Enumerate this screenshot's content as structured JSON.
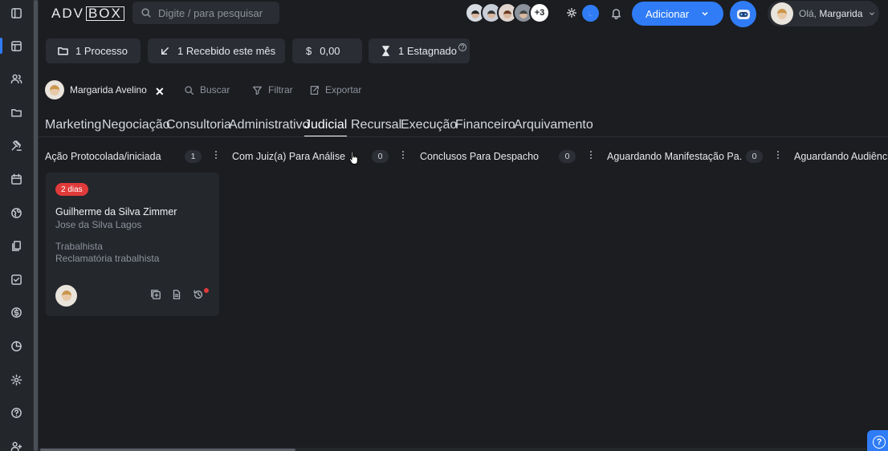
{
  "app": {
    "logo_left": "ADV",
    "logo_right": "BOX"
  },
  "search": {
    "placeholder": "Digite / para pesquisar"
  },
  "team": {
    "more_label": "+3"
  },
  "header": {
    "add_label": "Adicionar",
    "greeting": "Olá,",
    "user_name": "Margarida"
  },
  "stats": {
    "processes": "1 Processo",
    "received": "1 Recebido este mês",
    "amount_symbol": "$",
    "amount": "0,00",
    "stagnant": "1 Estagnado",
    "stagnant_help": "?"
  },
  "filters": {
    "user": "Margarida Avelino",
    "clear": "✕",
    "search": "Buscar",
    "filter": "Filtrar",
    "export": "Exportar"
  },
  "tabs": [
    {
      "label": "Marketing",
      "active": false
    },
    {
      "label": "Negociação",
      "active": false
    },
    {
      "label": "Consultoria",
      "active": false
    },
    {
      "label": "Administrativo",
      "active": false
    },
    {
      "label": "Judicial",
      "active": true
    },
    {
      "label": "Recursal",
      "active": false
    },
    {
      "label": "Execução",
      "active": false
    },
    {
      "label": "Financeiro",
      "active": false
    },
    {
      "label": "Arquivamento",
      "active": false
    }
  ],
  "columns": [
    {
      "title": "Ação Protocolada/iniciada",
      "count": "1"
    },
    {
      "title": "Com Juiz(a) Para Análise",
      "count": "0"
    },
    {
      "title": "Conclusos Para Despacho",
      "count": "0"
    },
    {
      "title": "Aguardando Manifestação Pa...",
      "count": "0"
    },
    {
      "title": "Aguardando Audiência"
    }
  ],
  "card": {
    "badge": "2 dias",
    "client": "Guilherme da Silva Zimmer",
    "opponent": "Jose da Silva Lagos",
    "area": "Trabalhista",
    "action_type": "Reclamatória trabalhista"
  },
  "colors": {
    "accent": "#2f7cf6",
    "danger": "#e03a3a",
    "background": "#1b1d21"
  },
  "help_fab": "?"
}
